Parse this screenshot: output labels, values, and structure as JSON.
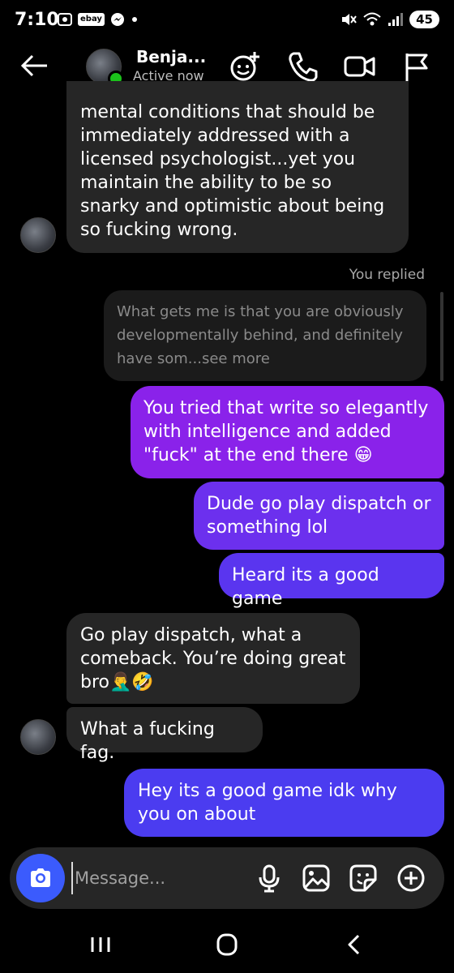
{
  "status_bar": {
    "time": "7:10",
    "ebay_label": "ebay",
    "battery": "45"
  },
  "header": {
    "name": "Benja...",
    "status": "Active now"
  },
  "messages": [
    {
      "side": "in",
      "text": "mental conditions that should be immediately addressed with a licensed psychologist...yet you maintain the ability to be so snarky and optimistic about being so fucking wrong."
    },
    {
      "side": "reply_label",
      "text": "You replied"
    },
    {
      "side": "quote",
      "text": "What gets me is that you are obviously developmentally behind, and definitely have som...see more"
    },
    {
      "side": "out",
      "text": "You tried that write so elegantly with intelligence and added \"fuck\" at the end there 😁"
    },
    {
      "side": "out",
      "text": "Dude go play dispatch or something lol"
    },
    {
      "side": "out",
      "text": "Heard its a good game"
    },
    {
      "side": "in",
      "text": "Go play dispatch, what a comeback. You’re doing great bro🤦‍♂️🤣"
    },
    {
      "side": "in",
      "text": "What a fucking fag."
    },
    {
      "side": "out",
      "text": "Hey its a good game idk why you on about"
    }
  ],
  "composer": {
    "placeholder": "Message..."
  },
  "colors": {
    "incoming_bubble": "#262626",
    "outgoing_top": "#8a2be2",
    "outgoing_bottom": "#4b3cf0",
    "camera_button": "#3b5bfd",
    "online": "#1bc21b"
  },
  "icons": [
    "back-arrow-icon",
    "add-people-icon",
    "phone-icon",
    "video-icon",
    "flag-icon",
    "camera-icon",
    "microphone-icon",
    "gallery-icon",
    "sticker-icon",
    "plus-icon",
    "recent-apps-icon",
    "home-icon",
    "back-nav-icon"
  ]
}
